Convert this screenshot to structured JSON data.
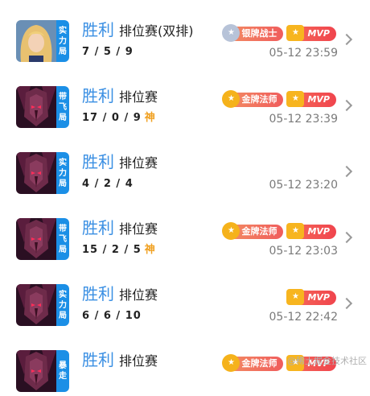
{
  "matches": [
    {
      "tag": [
        "实",
        "力",
        "局"
      ],
      "tag_color": "#1b8fe6",
      "portrait": "blonde-hero",
      "result": "胜利",
      "mode": "排位赛(双排)",
      "kda": "7 / 5 / 9",
      "god": "",
      "badges": [
        {
          "type": "silver",
          "label": "银牌战士"
        },
        {
          "type": "mvp",
          "label": "MVP"
        }
      ],
      "time": "05-12  23:59"
    },
    {
      "tag": [
        "带",
        "飞",
        "局"
      ],
      "tag_color": "#1b8fe6",
      "portrait": "dark-hero",
      "result": "胜利",
      "mode": "排位赛",
      "kda": "17 / 0 / 9",
      "god": "神",
      "badges": [
        {
          "type": "gold",
          "label": "金牌法师"
        },
        {
          "type": "mvp",
          "label": "MVP"
        }
      ],
      "time": "05-12  23:39"
    },
    {
      "tag": [
        "实",
        "力",
        "局"
      ],
      "tag_color": "#1b8fe6",
      "portrait": "dark-hero",
      "result": "胜利",
      "mode": "排位赛",
      "kda": "4 / 2 / 4",
      "god": "",
      "badges": [],
      "time": "05-12  23:20"
    },
    {
      "tag": [
        "带",
        "飞",
        "局"
      ],
      "tag_color": "#1b8fe6",
      "portrait": "dark-hero",
      "result": "胜利",
      "mode": "排位赛",
      "kda": "15 / 2 / 5",
      "god": "神",
      "badges": [
        {
          "type": "gold",
          "label": "金牌法师"
        },
        {
          "type": "mvp",
          "label": "MVP"
        }
      ],
      "time": "05-12  23:03"
    },
    {
      "tag": [
        "实",
        "力",
        "局"
      ],
      "tag_color": "#1b8fe6",
      "portrait": "dark-hero",
      "result": "胜利",
      "mode": "排位赛",
      "kda": "6 / 6 / 10",
      "god": "",
      "badges": [
        {
          "type": "mvp",
          "label": "MVP"
        }
      ],
      "time": "05-12  22:42"
    },
    {
      "tag": [
        "暴",
        "走"
      ],
      "tag_color": "#1b8fe6",
      "portrait": "dark-hero",
      "result": "胜利",
      "mode": "排位赛",
      "kda": "",
      "god": "",
      "badges": [
        {
          "type": "gold",
          "label": "金牌法师"
        },
        {
          "type": "mvp",
          "label": "MVP"
        }
      ],
      "time": ""
    }
  ],
  "watermark": "@稀土掘金技术社区"
}
